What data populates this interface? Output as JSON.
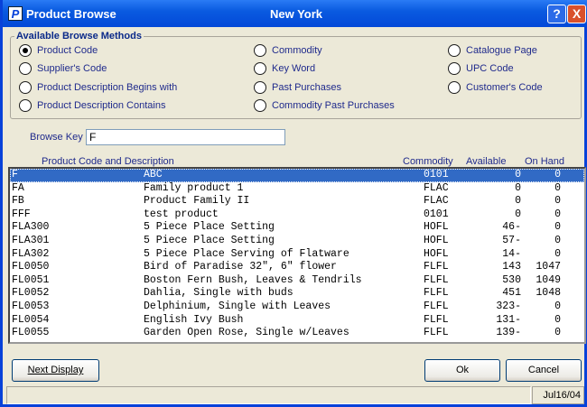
{
  "window": {
    "title": "Product Browse",
    "location": "New York",
    "app_icon": "P",
    "help": "?",
    "close": "X"
  },
  "browse_methods": {
    "legend": "Available Browse Methods",
    "options": [
      {
        "label": "Product Code",
        "selected": true
      },
      {
        "label": "Supplier's Code",
        "selected": false
      },
      {
        "label": "Product Description Begins with",
        "selected": false
      },
      {
        "label": "Product Description Contains",
        "selected": false
      },
      {
        "label": "Commodity",
        "selected": false
      },
      {
        "label": "Key Word",
        "selected": false
      },
      {
        "label": "Past Purchases",
        "selected": false
      },
      {
        "label": "Commodity Past Purchases",
        "selected": false
      },
      {
        "label": "Catalogue Page",
        "selected": false
      },
      {
        "label": "UPC Code",
        "selected": false
      },
      {
        "label": "Customer's Code",
        "selected": false
      }
    ]
  },
  "browse_key": {
    "label": "Browse Key",
    "value": "F"
  },
  "columns": {
    "product": "Product Code and Description",
    "commodity": "Commodity",
    "available": "Available",
    "on_hand": "On Hand"
  },
  "rows": [
    [
      "F",
      "ABC",
      "0101",
      "0",
      "0"
    ],
    [
      "FA",
      "Family product 1",
      "FLAC",
      "0",
      "0"
    ],
    [
      "FB",
      "Product Family II",
      "FLAC",
      "0",
      "0"
    ],
    [
      "FFF",
      "test product",
      "0101",
      "0",
      "0"
    ],
    [
      "FLA300",
      "5 Piece Place Setting",
      "HOFL",
      "46-",
      "0"
    ],
    [
      "FLA301",
      "5 Piece Place Setting",
      "HOFL",
      "57-",
      "0"
    ],
    [
      "FLA302",
      "5 Piece Place Serving of Flatware",
      "HOFL",
      "14-",
      "0"
    ],
    [
      "FL0050",
      "Bird of Paradise 32\", 6\" flower",
      "FLFL",
      "143",
      "1047"
    ],
    [
      "FL0051",
      "Boston Fern Bush, Leaves & Tendrils",
      "FLFL",
      "530",
      "1049"
    ],
    [
      "FL0052",
      "Dahlia, Single with buds",
      "FLFL",
      "451",
      "1048"
    ],
    [
      "FL0053",
      "Delphinium, Single with Leaves",
      "FLFL",
      "323-",
      "0"
    ],
    [
      "FL0054",
      "English Ivy Bush",
      "FLFL",
      "131-",
      "0"
    ],
    [
      "FL0055",
      "Garden Open Rose, Single w/Leaves",
      "FLFL",
      "139-",
      "0"
    ]
  ],
  "buttons": {
    "next": "Next Display",
    "ok": "Ok",
    "cancel": "Cancel"
  },
  "status": {
    "date": "Jul16/04"
  }
}
